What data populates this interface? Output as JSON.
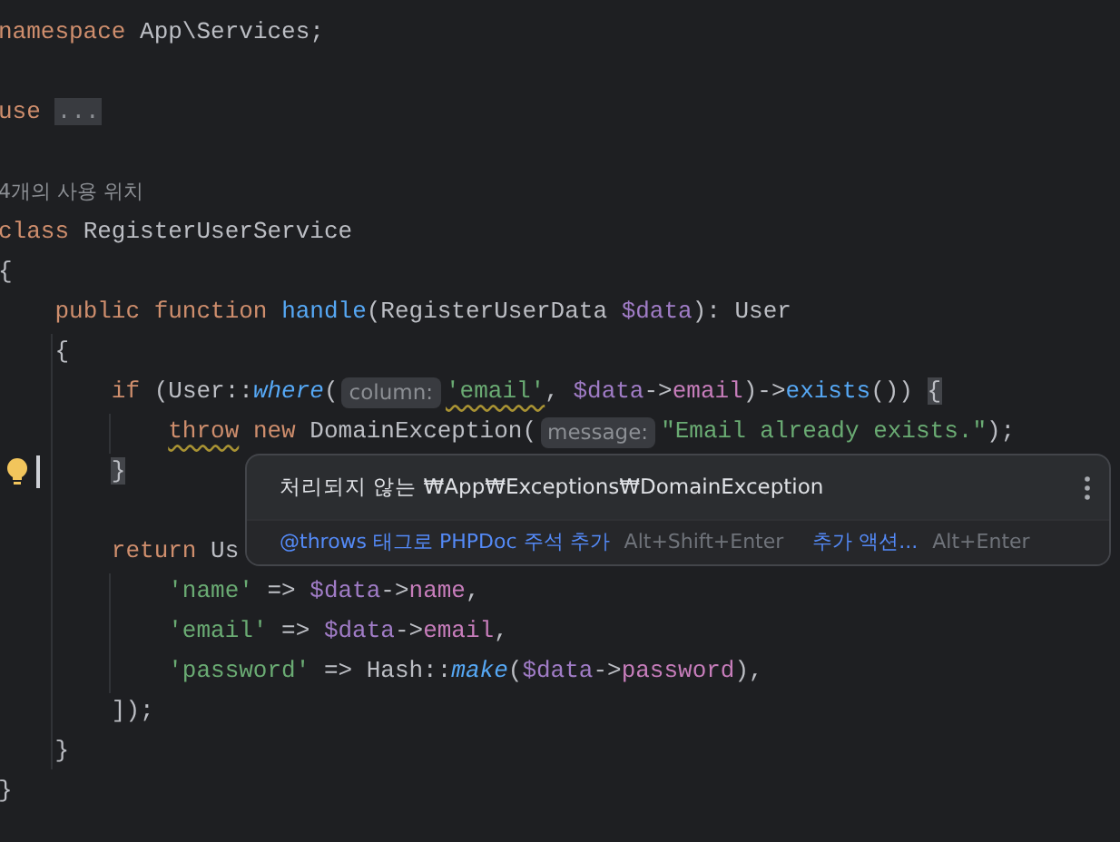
{
  "editor": {
    "lines": [
      {
        "kind": "code",
        "tokens": [
          {
            "kind": "keyword",
            "text": "namespace"
          },
          {
            "kind": "plain",
            "text": " App\\Services;"
          }
        ]
      },
      {
        "kind": "blank"
      },
      {
        "kind": "code",
        "tokens": [
          {
            "kind": "keyword",
            "text": "use"
          },
          {
            "kind": "fold",
            "text": "..."
          }
        ]
      },
      {
        "kind": "blank"
      },
      {
        "kind": "usage_hint",
        "text": "4개의 사용 위치"
      },
      {
        "kind": "code",
        "tokens": [
          {
            "kind": "keyword",
            "text": "class"
          },
          {
            "kind": "plain",
            "text": " RegisterUserService"
          }
        ]
      },
      {
        "kind": "code",
        "tokens": [
          {
            "kind": "plain",
            "text": "{"
          }
        ]
      },
      {
        "kind": "code",
        "tokens": [
          {
            "kind": "keyword",
            "text": "    public function"
          },
          {
            "kind": "function",
            "text": " handle"
          },
          {
            "kind": "plain",
            "text": "(RegisterUserData "
          },
          {
            "kind": "variable",
            "text": "$data"
          },
          {
            "kind": "plain",
            "text": "): User"
          }
        ]
      },
      {
        "kind": "code",
        "tokens": [
          {
            "kind": "plain",
            "text": "    {"
          }
        ]
      },
      {
        "kind": "code",
        "tokens": [
          {
            "kind": "keyword",
            "text": "        if"
          },
          {
            "kind": "plain",
            "text": " (User::"
          },
          {
            "kind": "static_call",
            "text": "where"
          },
          {
            "kind": "plain",
            "text": "("
          },
          {
            "kind": "param_hint",
            "text": "column:"
          },
          {
            "kind": "string_warned",
            "text": "'email'"
          },
          {
            "kind": "plain",
            "text": ", "
          },
          {
            "kind": "variable",
            "text": "$data"
          },
          {
            "kind": "plain",
            "text": "->"
          },
          {
            "kind": "field",
            "text": "email"
          },
          {
            "kind": "plain",
            "text": ")->"
          },
          {
            "kind": "function",
            "text": "exists"
          },
          {
            "kind": "plain",
            "text": "()) "
          },
          {
            "kind": "brace_match",
            "text": "{"
          }
        ]
      },
      {
        "kind": "code",
        "tokens": [
          {
            "kind": "keyword_warned",
            "text": "            throw"
          },
          {
            "kind": "keyword",
            "text": " new"
          },
          {
            "kind": "plain",
            "text": " DomainException("
          },
          {
            "kind": "param_hint",
            "text": "message:"
          },
          {
            "kind": "string",
            "text": "\"Email already exists.\""
          },
          {
            "kind": "plain",
            "text": ");"
          }
        ]
      },
      {
        "kind": "code",
        "tokens": [
          {
            "kind": "brace_match",
            "text": "        }"
          }
        ]
      },
      {
        "kind": "blank"
      },
      {
        "kind": "code",
        "tokens": [
          {
            "kind": "keyword",
            "text": "        return"
          },
          {
            "kind": "plain",
            "text": " Us"
          }
        ]
      },
      {
        "kind": "code",
        "tokens": [
          {
            "kind": "string",
            "text": "            'name'"
          },
          {
            "kind": "plain",
            "text": " => "
          },
          {
            "kind": "variable",
            "text": "$data"
          },
          {
            "kind": "plain",
            "text": "->"
          },
          {
            "kind": "field",
            "text": "name"
          },
          {
            "kind": "plain",
            "text": ","
          }
        ]
      },
      {
        "kind": "code",
        "tokens": [
          {
            "kind": "string",
            "text": "            'email'"
          },
          {
            "kind": "plain",
            "text": " => "
          },
          {
            "kind": "variable",
            "text": "$data"
          },
          {
            "kind": "plain",
            "text": "->"
          },
          {
            "kind": "field",
            "text": "email"
          },
          {
            "kind": "plain",
            "text": ","
          }
        ]
      },
      {
        "kind": "code",
        "tokens": [
          {
            "kind": "string",
            "text": "            'password'"
          },
          {
            "kind": "plain",
            "text": " => Hash::"
          },
          {
            "kind": "static_call",
            "text": "make"
          },
          {
            "kind": "plain",
            "text": "("
          },
          {
            "kind": "variable",
            "text": "$data"
          },
          {
            "kind": "plain",
            "text": "->"
          },
          {
            "kind": "field",
            "text": "password"
          },
          {
            "kind": "plain",
            "text": "),"
          }
        ]
      },
      {
        "kind": "code",
        "tokens": [
          {
            "kind": "plain",
            "text": "        ]);"
          }
        ]
      },
      {
        "kind": "code",
        "tokens": [
          {
            "kind": "plain",
            "text": "    }"
          }
        ]
      },
      {
        "kind": "code",
        "tokens": [
          {
            "kind": "plain",
            "text": "}"
          }
        ]
      }
    ]
  },
  "popup": {
    "message": "처리되지 않는 ₩App₩Exceptions₩DomainException",
    "actions": [
      {
        "label": "@throws 태그로 PHPDoc 주석 추가",
        "shortcut": "Alt+Shift+Enter"
      },
      {
        "label": "추가 액션...",
        "shortcut": "Alt+Enter"
      }
    ]
  }
}
